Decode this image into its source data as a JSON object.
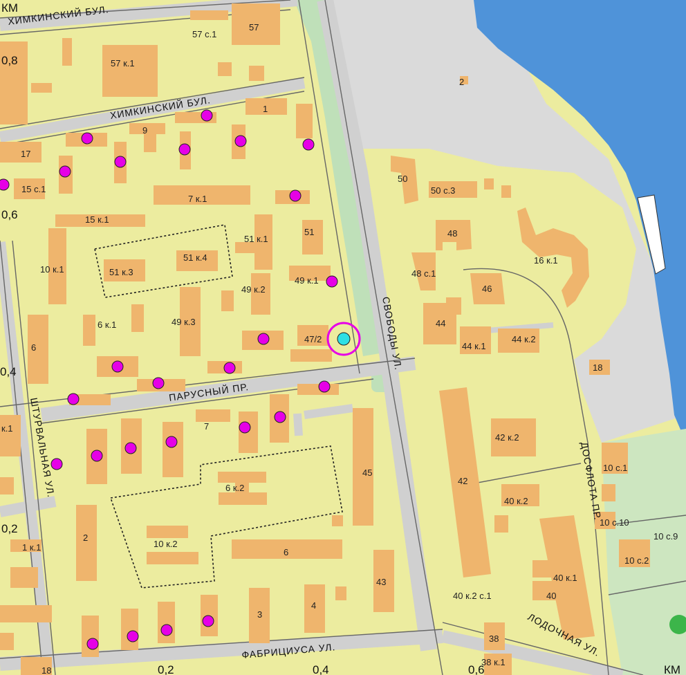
{
  "map": {
    "colors": {
      "land": "#ecec9f",
      "road": "#dadada",
      "water": "#4f93d9",
      "building": "#efb56d",
      "greenery": "#bfe0b9",
      "poi_fill": "#e600e6",
      "marker": "#2ee0e4"
    },
    "streets": {
      "khimkinsky_top": "ХИМКИНСКИЙ БУЛ.",
      "khimkinsky": "ХИМКИНСКИЙ БУЛ.",
      "svobody": "СВОБОДЫ УЛ.",
      "parusny": "ПАРУСНЫЙ ПР.",
      "shturvalnaya": "ШТУРВАЛЬНАЯ УЛ.",
      "dosflota": "ДОСФЛОТА ПР.",
      "fabritsiusa": "ФАБРИЦИУСА УЛ.",
      "lodochnaya": "ЛОДОЧНАЯ УЛ."
    },
    "scale": {
      "top_unit": "КМ",
      "bottom_unit": "КМ",
      "l08": "0,8",
      "l06": "0,6",
      "l04": "0,4",
      "l02": "0,2",
      "b02": "0,2",
      "b04": "0,4",
      "b06": "0,6"
    },
    "buildings": {
      "b57": "57",
      "b57s1": "57 с.1",
      "b57k1": "57 к.1",
      "b1": "1",
      "b9": "9",
      "b17": "17",
      "b15s1": "15 с.1",
      "b7k1": "7 к.1",
      "b15k1": "15 к.1",
      "b51k1": "51 к.1",
      "b51": "51",
      "b51k4": "51 к.4",
      "b51k3": "51 к.3",
      "b10k1": "10 к.1",
      "b49k1": "49 к.1",
      "b49k2": "49 к.2",
      "b49k3": "49 к.3",
      "b6k1": "6 к.1",
      "b6": "6",
      "b47_2": "47/2",
      "b2_north": "2",
      "b50": "50",
      "b50s3": "50 с.3",
      "b48": "48",
      "b48s1": "48 с.1",
      "b16k1": "16 к.1",
      "b46": "46",
      "b44": "44",
      "b44k1": "44 к.1",
      "b44k2": "44 к.2",
      "b18e": "18",
      "b7": "7",
      "b45": "45",
      "b6k2": "6 к.2",
      "b10k2": "10 к.2",
      "b6s": "6",
      "b2s": "2",
      "b1k1": "1 к.1",
      "bk1w": "к.1",
      "b43": "43",
      "b3": "3",
      "b4": "4",
      "b42k2": "42 к.2",
      "b42": "42",
      "b40k2": "40 к.2",
      "b40k1": "40 к.1",
      "b40k2s1": "40 к.2 с.1",
      "b40": "40",
      "b10c1": "10 с.1",
      "b10c10": "10 с.10",
      "b10c9": "10 с.9",
      "b10c2": "10 с.2",
      "b38": "38",
      "b38k1": "38 к.1",
      "b18sw": "18"
    }
  }
}
